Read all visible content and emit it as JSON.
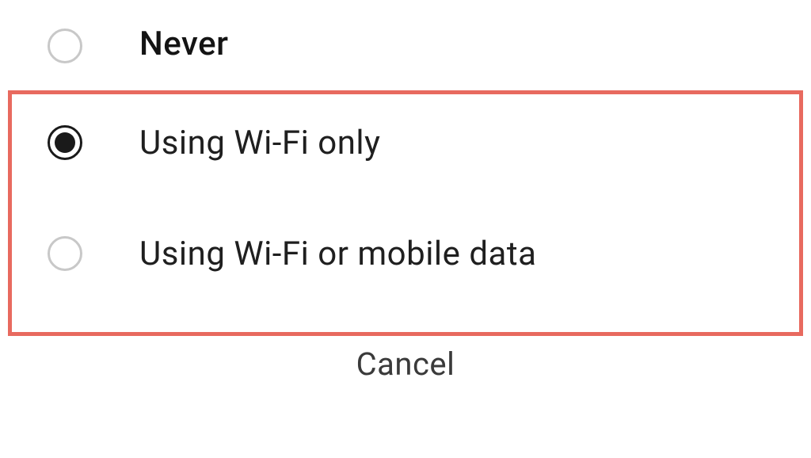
{
  "options": [
    {
      "label": "Never",
      "selected": false
    },
    {
      "label": "Using Wi-Fi only",
      "selected": true
    },
    {
      "label": "Using Wi-Fi or mobile data",
      "selected": false
    }
  ],
  "cancel_label": "Cancel",
  "highlight_color": "#e86a5f"
}
